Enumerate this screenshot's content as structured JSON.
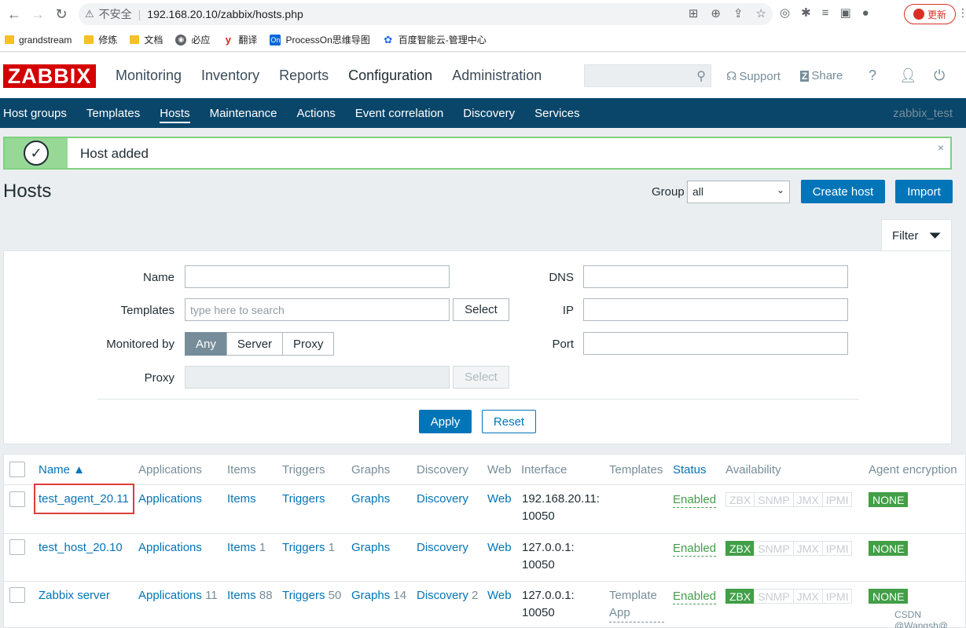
{
  "browser": {
    "security_label": "不安全",
    "url": "192.168.20.10/zabbix/hosts.php",
    "update_label": "更新"
  },
  "bookmarks": [
    {
      "label": "grandstream",
      "icon": "folder-icon"
    },
    {
      "label": "修炼",
      "icon": "folder-icon"
    },
    {
      "label": "文档",
      "icon": "folder-icon"
    },
    {
      "label": "必应",
      "icon": "globe-icon"
    },
    {
      "label": "翻译",
      "icon": "youdao-icon"
    },
    {
      "label": "ProcessOn思维导图",
      "icon": "processon-icon"
    },
    {
      "label": "百度智能云-管理中心",
      "icon": "baidu-cloud-icon"
    }
  ],
  "header": {
    "logo": "ZABBIX",
    "nav": [
      "Monitoring",
      "Inventory",
      "Reports",
      "Configuration",
      "Administration"
    ],
    "active_nav": "Configuration",
    "support": "Support",
    "share": "Share",
    "help": "?"
  },
  "subnav": {
    "items": [
      "Host groups",
      "Templates",
      "Hosts",
      "Maintenance",
      "Actions",
      "Event correlation",
      "Discovery",
      "Services"
    ],
    "active": "Hosts",
    "user": "zabbix_test"
  },
  "message": {
    "text": "Host added",
    "close": "×"
  },
  "page": {
    "title": "Hosts",
    "group_label": "Group",
    "group_value": "all",
    "create_host": "Create host",
    "import": "Import"
  },
  "filter": {
    "tab_label": "Filter",
    "name_label": "Name",
    "templates_label": "Templates",
    "templates_placeholder": "type here to search",
    "select_label": "Select",
    "monitored_by_label": "Monitored by",
    "monitored_options": [
      "Any",
      "Server",
      "Proxy"
    ],
    "monitored_selected": "Any",
    "proxy_label": "Proxy",
    "dns_label": "DNS",
    "ip_label": "IP",
    "port_label": "Port",
    "apply": "Apply",
    "reset": "Reset"
  },
  "table": {
    "headers": [
      "Name ▲",
      "Applications",
      "Items",
      "Triggers",
      "Graphs",
      "Discovery",
      "Web",
      "Interface",
      "Templates",
      "Status",
      "Availability",
      "Agent encryption"
    ],
    "rows": [
      {
        "name": "test_agent_20.11",
        "applications": "Applications",
        "applications_count": "",
        "items": "Items",
        "items_count": "",
        "triggers": "Triggers",
        "triggers_count": "",
        "graphs": "Graphs",
        "graphs_count": "",
        "discovery": "Discovery",
        "discovery_count": "",
        "web": "Web",
        "interface_line1": "192.168.20.11:",
        "interface_line2": "10050",
        "templates": "",
        "status": "Enabled",
        "availability": [
          "ZBX",
          "SNMP",
          "JMX",
          "IPMI"
        ],
        "zbx_active": false,
        "encryption": "NONE"
      },
      {
        "name": "test_host_20.10",
        "applications": "Applications",
        "applications_count": "",
        "items": "Items",
        "items_count": "1",
        "triggers": "Triggers",
        "triggers_count": "1",
        "graphs": "Graphs",
        "graphs_count": "",
        "discovery": "Discovery",
        "discovery_count": "",
        "web": "Web",
        "interface_line1": "127.0.0.1:",
        "interface_line2": "10050",
        "templates": "",
        "status": "Enabled",
        "availability": [
          "ZBX",
          "SNMP",
          "JMX",
          "IPMI"
        ],
        "zbx_active": true,
        "encryption": "NONE"
      },
      {
        "name": "Zabbix server",
        "applications": "Applications",
        "applications_count": "11",
        "items": "Items",
        "items_count": "88",
        "triggers": "Triggers",
        "triggers_count": "50",
        "graphs": "Graphs",
        "graphs_count": "14",
        "discovery": "Discovery",
        "discovery_count": "2",
        "web": "Web",
        "interface_line1": "127.0.0.1:",
        "interface_line2": "10050",
        "templates": "Template App",
        "status": "Enabled",
        "availability": [
          "ZBX",
          "SNMP",
          "JMX",
          "IPMI"
        ],
        "zbx_active": true,
        "encryption": "NONE"
      }
    ]
  },
  "watermark": "CSDN @Wangsh@"
}
